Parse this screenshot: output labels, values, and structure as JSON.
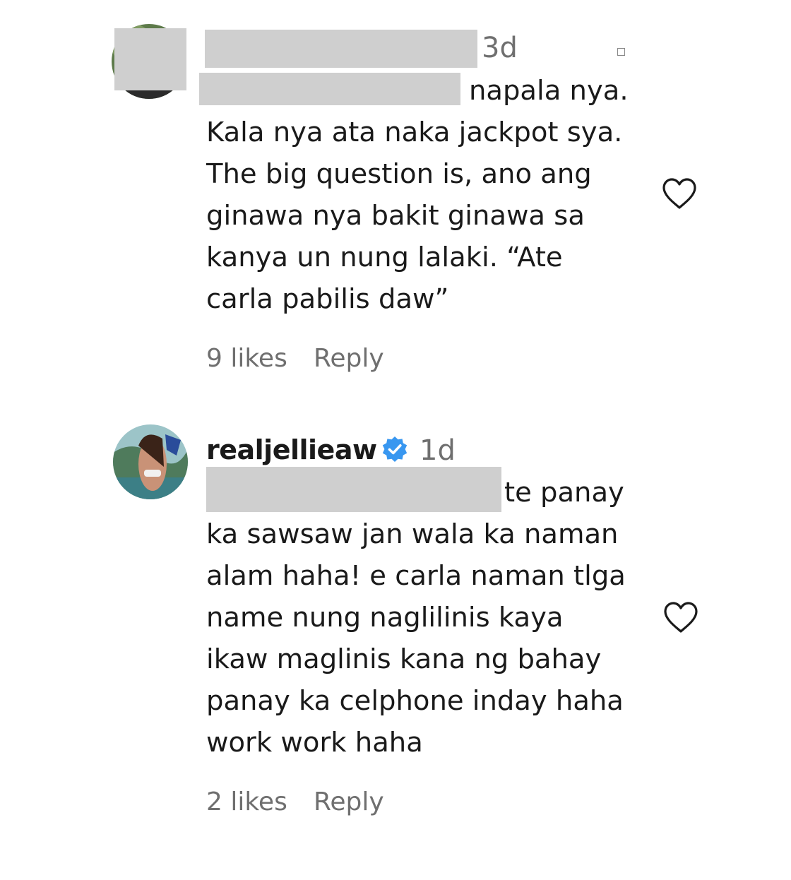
{
  "comments": [
    {
      "username": "",
      "time": "3d",
      "lines": [
        "napala nya.",
        "Kala nya ata naka jackpot sya.",
        "The big question is, ano ang",
        "ginawa nya bakit ginawa sa",
        "kanya un nung lalaki. “Ate",
        "carla pabilis daw”"
      ],
      "likes": "9 likes",
      "reply": "Reply",
      "heart_icon": "heart-outline-icon"
    },
    {
      "username": "realjellieaw",
      "time": "1d",
      "verified_icon": "verified-badge-icon",
      "lines": [
        "te panay",
        "ka sawsaw jan wala ka naman",
        "alam haha! e carla naman tlga",
        "name nung naglilinis kaya",
        "ikaw maglinis kana ng bahay",
        "panay ka celphone inday haha",
        "work work haha"
      ],
      "likes": "2 likes",
      "reply": "Reply",
      "heart_icon": "heart-outline-icon"
    }
  ],
  "colors": {
    "text": "#1a1a1a",
    "muted": "#6f6f6f",
    "verified": "#3897f0",
    "redaction": "#cfcfcf"
  }
}
